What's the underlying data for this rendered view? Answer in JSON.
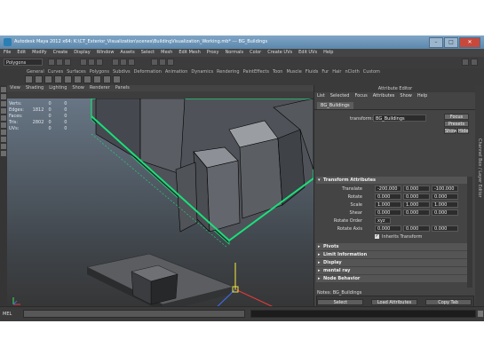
{
  "window": {
    "title": "Autodesk Maya 2012 x64: K:\\CT_Exterior_Visualization\\scenes\\BuildingVisualization_Working.mb* --- BG_Buildings"
  },
  "window_controls": {
    "minimize": "–",
    "maximize": "□",
    "close": "✕"
  },
  "menu": [
    "File",
    "Edit",
    "Modify",
    "Create",
    "Display",
    "Window",
    "Assets",
    "Select",
    "Mesh",
    "Edit Mesh",
    "Proxy",
    "Normals",
    "Color",
    "Create UVs",
    "Edit UVs",
    "Help"
  ],
  "mode_selector": {
    "value": "Polygons"
  },
  "shelf_tabs": [
    "General",
    "Curves",
    "Surfaces",
    "Polygons",
    "Subdivs",
    "Deformation",
    "Animation",
    "Dynamics",
    "Rendering",
    "PaintEffects",
    "Toon",
    "Muscle",
    "Fluids",
    "Fur",
    "Hair",
    "nCloth",
    "Custom"
  ],
  "viewport": {
    "menu": [
      "View",
      "Shading",
      "Lighting",
      "Show",
      "Renderer",
      "Panels"
    ],
    "stats": [
      {
        "label": "Verts:",
        "a": "",
        "b": "0",
        "c": "0"
      },
      {
        "label": "Edges:",
        "a": "1812",
        "b": "0",
        "c": "0"
      },
      {
        "label": "Faces:",
        "a": "",
        "b": "0",
        "c": "0"
      },
      {
        "label": "Tris:",
        "a": "2802",
        "b": "0",
        "c": "0"
      },
      {
        "label": "UVs:",
        "a": "",
        "b": "0",
        "c": "0"
      }
    ]
  },
  "attribute_editor": {
    "header": "Attribute Editor",
    "menu": [
      "List",
      "Selected",
      "Focus",
      "Attributes",
      "Show",
      "Help"
    ],
    "node_tab": "BG_Buildings",
    "transform_label": "transform:",
    "transform_name": "BG_Buildings",
    "focus_button": "Focus",
    "presets_button": "Presets",
    "show_button": "Show",
    "hide_button": "Hide",
    "section_transform": "Transform Attributes",
    "attributes": [
      {
        "label": "Translate",
        "values": [
          "-200.000",
          "0.000",
          "-100.000"
        ]
      },
      {
        "label": "Rotate",
        "values": [
          "0.000",
          "0.000",
          "0.000"
        ]
      },
      {
        "label": "Scale",
        "values": [
          "1.000",
          "1.000",
          "1.000"
        ]
      },
      {
        "label": "Shear",
        "values": [
          "0.000",
          "0.000",
          "0.000"
        ]
      },
      {
        "label": "Rotate Order",
        "values": [
          "xyz"
        ]
      },
      {
        "label": "Rotate Axis",
        "values": [
          "0.000",
          "0.000",
          "0.000"
        ]
      }
    ],
    "inherits_label": "Inherits Transform",
    "sections": [
      "Pivots",
      "Limit Information",
      "Display",
      "mental ray",
      "Node Behavior"
    ],
    "notes_label": "Notes:  BG_Buildings",
    "buttons": [
      "Select",
      "Load Attributes",
      "Copy Tab"
    ]
  },
  "side_tabs": "Channel Box / Layer Editor",
  "command_line": {
    "mel_label": "MEL"
  },
  "colors": {
    "wire": "#19e07a",
    "title_bar": "#6b93b6",
    "panel": "#444444"
  }
}
